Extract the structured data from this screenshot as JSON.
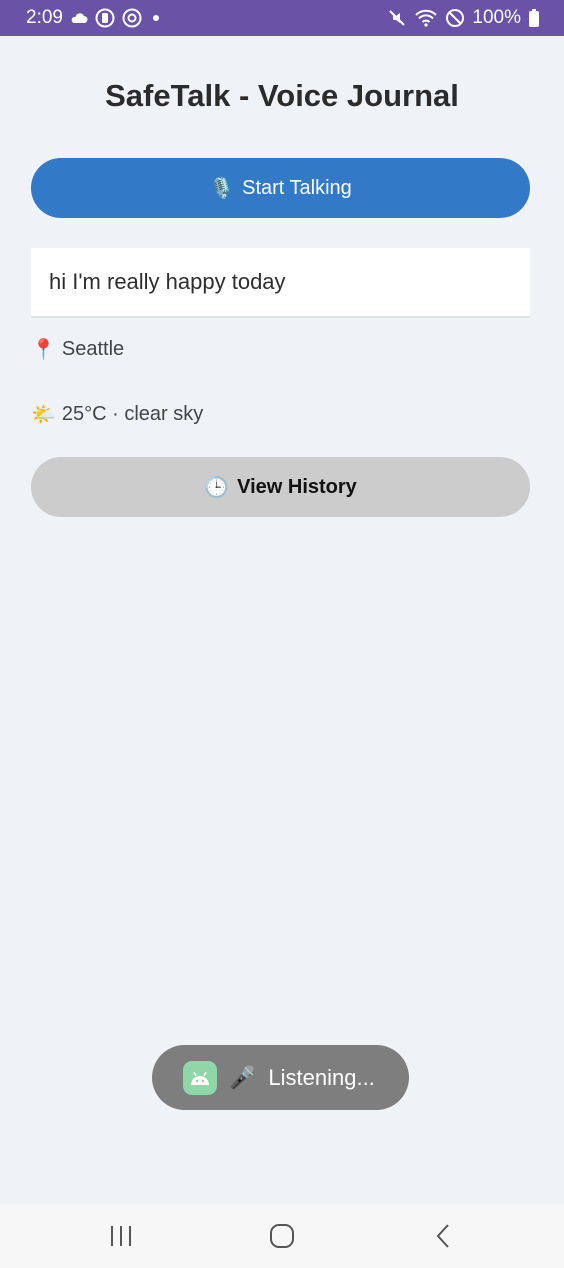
{
  "status_bar": {
    "time": "2:09",
    "battery": "100%",
    "left_icons": [
      "cloud-icon",
      "app-circle-icon",
      "sync-circle-icon",
      "dot-icon"
    ],
    "right_icons": [
      "mute-icon",
      "wifi-icon",
      "dnd-icon",
      "battery-icon"
    ],
    "background_color": "#6a53a6"
  },
  "app": {
    "title": "SafeTalk - Voice Journal",
    "start_button": {
      "emoji": "🎙️",
      "label": "Start Talking",
      "color": "#3279c8"
    },
    "transcript": "hi I'm really happy today",
    "location": {
      "emoji": "📍",
      "text": "Seattle"
    },
    "weather": {
      "emoji": "🌤️",
      "text": "25°C · clear sky"
    },
    "history_button": {
      "emoji": "🕒",
      "label": "View History",
      "color": "#cccccc"
    }
  },
  "toast": {
    "emoji": "🎤",
    "text": "Listening...",
    "icon": "android-icon"
  },
  "nav_bar": {
    "buttons": [
      "recents-icon",
      "home-icon",
      "back-icon"
    ]
  }
}
